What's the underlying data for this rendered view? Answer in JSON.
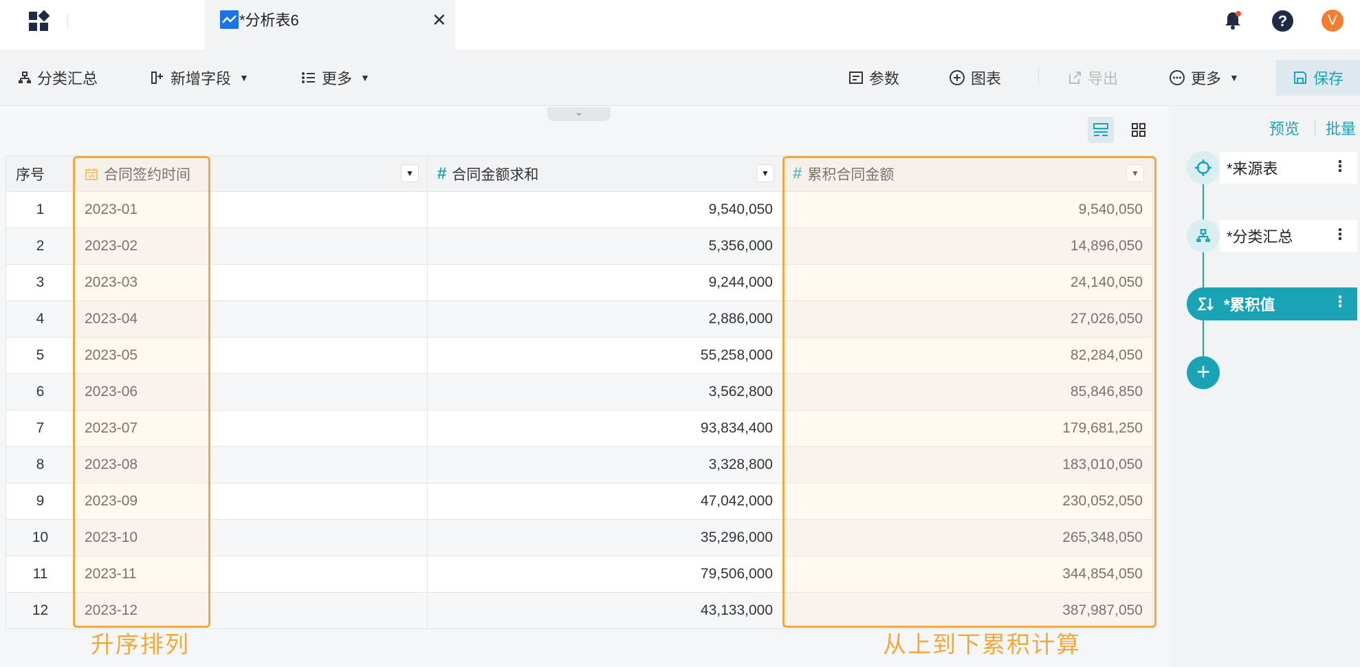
{
  "tab": {
    "title": "*分析表6",
    "close": "✕"
  },
  "header": {
    "avatar_letter": "V",
    "help": "?"
  },
  "toolbar": {
    "group_label": "分类汇总",
    "add_field_label": "新增字段",
    "more_left_label": "更多",
    "params_label": "参数",
    "chart_label": "图表",
    "export_label": "导出",
    "more_right_label": "更多",
    "save_label": "保存"
  },
  "table": {
    "columns": [
      "序号",
      "合同签约时间",
      "合同金额求和",
      "累积合同金额"
    ],
    "rows": [
      {
        "idx": "1",
        "date": "2023-01",
        "amount": "9,540,050",
        "cumulative": "9,540,050"
      },
      {
        "idx": "2",
        "date": "2023-02",
        "amount": "5,356,000",
        "cumulative": "14,896,050"
      },
      {
        "idx": "3",
        "date": "2023-03",
        "amount": "9,244,000",
        "cumulative": "24,140,050"
      },
      {
        "idx": "4",
        "date": "2023-04",
        "amount": "2,886,000",
        "cumulative": "27,026,050"
      },
      {
        "idx": "5",
        "date": "2023-05",
        "amount": "55,258,000",
        "cumulative": "82,284,050"
      },
      {
        "idx": "6",
        "date": "2023-06",
        "amount": "3,562,800",
        "cumulative": "85,846,850"
      },
      {
        "idx": "7",
        "date": "2023-07",
        "amount": "93,834,400",
        "cumulative": "179,681,250"
      },
      {
        "idx": "8",
        "date": "2023-08",
        "amount": "3,328,800",
        "cumulative": "183,010,050"
      },
      {
        "idx": "9",
        "date": "2023-09",
        "amount": "47,042,000",
        "cumulative": "230,052,050"
      },
      {
        "idx": "10",
        "date": "2023-10",
        "amount": "35,296,000",
        "cumulative": "265,348,050"
      },
      {
        "idx": "11",
        "date": "2023-11",
        "amount": "79,506,000",
        "cumulative": "344,854,050"
      },
      {
        "idx": "12",
        "date": "2023-12",
        "amount": "43,133,000",
        "cumulative": "387,987,050"
      }
    ]
  },
  "annotations": {
    "left": "升序排列",
    "right": "从上到下累积计算"
  },
  "side": {
    "preview_label": "预览",
    "batch_label": "批量",
    "nodes": [
      "*来源表",
      "*分类汇总",
      "*累积值"
    ],
    "add": "+"
  },
  "colors": {
    "accent": "#1aa3b5",
    "highlight": "#f2a93b",
    "tab_icon": "#1a73e8",
    "avatar": "#f07f2f"
  }
}
